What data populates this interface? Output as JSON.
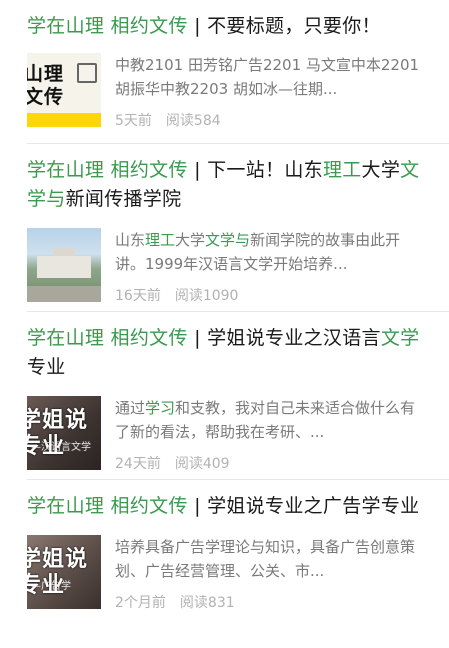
{
  "articles": [
    {
      "title_parts": [
        {
          "text": "学在山理 相约文传",
          "hl": true
        },
        {
          "text": " | 不要标题，只要你！",
          "hl": false
        }
      ],
      "digest_parts": [
        {
          "text": "中教2101 田芳铭广告2201 马文宣中本2201 胡振华中教2203 胡如冰—往期...",
          "hl": false
        }
      ],
      "time": "5天前",
      "reads": "阅读584",
      "thumb_text": "山理\n文传"
    },
    {
      "title_parts": [
        {
          "text": "学在山理 相约文传",
          "hl": true
        },
        {
          "text": " | 下一站！山东",
          "hl": false
        },
        {
          "text": "理工",
          "hl": true
        },
        {
          "text": "大学",
          "hl": false
        },
        {
          "text": "文学与",
          "hl": true
        },
        {
          "text": "新闻传播学院",
          "hl": false
        }
      ],
      "digest_parts": [
        {
          "text": "山东",
          "hl": false
        },
        {
          "text": "理工",
          "hl": true
        },
        {
          "text": "大学",
          "hl": false
        },
        {
          "text": "文学与",
          "hl": true
        },
        {
          "text": "新闻学院的故事由此开讲。1999年汉语言文学开始培养...",
          "hl": false
        }
      ],
      "time": "16天前",
      "reads": "阅读1090",
      "thumb_text": ""
    },
    {
      "title_parts": [
        {
          "text": "学在山理 相约文传",
          "hl": true
        },
        {
          "text": " | 学姐说专业之汉语言",
          "hl": false
        },
        {
          "text": "文学",
          "hl": true
        },
        {
          "text": "专业",
          "hl": false
        }
      ],
      "digest_parts": [
        {
          "text": "通过",
          "hl": false
        },
        {
          "text": "学习",
          "hl": true
        },
        {
          "text": "和支教，我对自己未来适合做什么有了新的看法，帮助我在考研、...",
          "hl": false
        }
      ],
      "time": "24天前",
      "reads": "阅读409",
      "thumb_text": "学姐说专业",
      "thumb_sub": "—汉语言文学"
    },
    {
      "title_parts": [
        {
          "text": "学在山理 相约文传",
          "hl": true
        },
        {
          "text": " | 学姐说专业之广告学专业",
          "hl": false
        }
      ],
      "digest_parts": [
        {
          "text": "培养具备广告学理论与知识，具备广告创意策划、广告经营管理、公关、市...",
          "hl": false
        }
      ],
      "time": "2个月前",
      "reads": "阅读831",
      "thumb_text": "学姐说专业",
      "thumb_sub": "—广告学"
    }
  ]
}
